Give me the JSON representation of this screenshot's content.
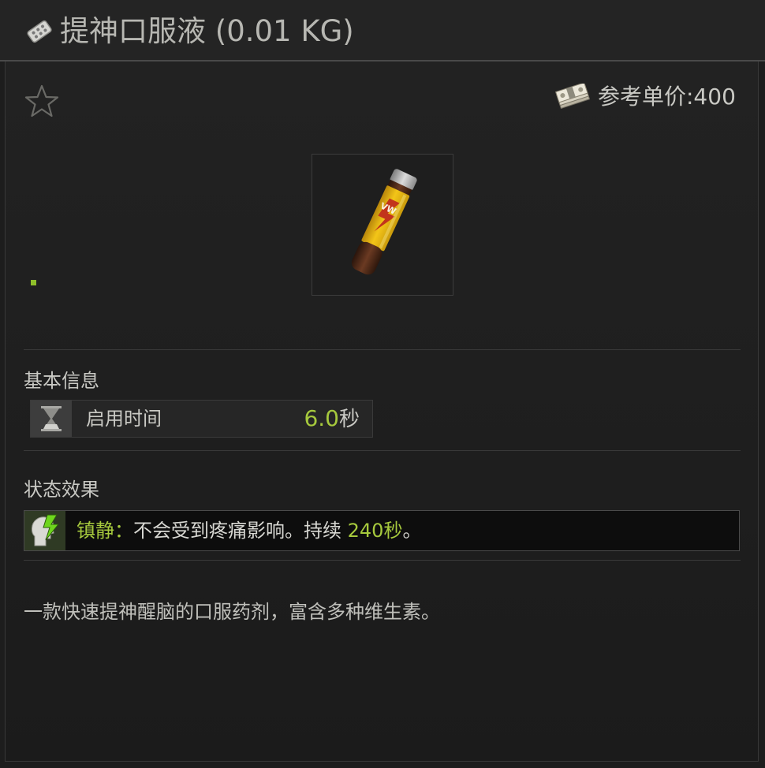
{
  "window": {
    "title": "提神口服液 (0.01 KG)",
    "title_icon": "pill-pack-icon"
  },
  "header": {
    "favorite_icon": "star-icon",
    "price_icon": "money-stack-icon",
    "price_text": "参考单价:400"
  },
  "item": {
    "image_name": "oral-stimulant-vial-image"
  },
  "basic_info": {
    "heading": "基本信息",
    "rows": [
      {
        "icon": "hourglass-icon",
        "label": "启用时间",
        "value": "6.0",
        "unit": "秒"
      }
    ]
  },
  "status_effects": {
    "heading": "状态效果",
    "effects": [
      {
        "icon": "head-lightning-icon",
        "name": "镇静：",
        "text": "不会受到疼痛影响。持续 ",
        "duration": "240秒",
        "suffix": "。"
      }
    ]
  },
  "description": "一款快速提神醒脑的口服药剂，富含多种维生素。",
  "colors": {
    "accent_green": "#a6c93d",
    "background": "#1d1d1d",
    "effect_row_bg": "#0d0d0d",
    "text": "#c9c9c4"
  }
}
